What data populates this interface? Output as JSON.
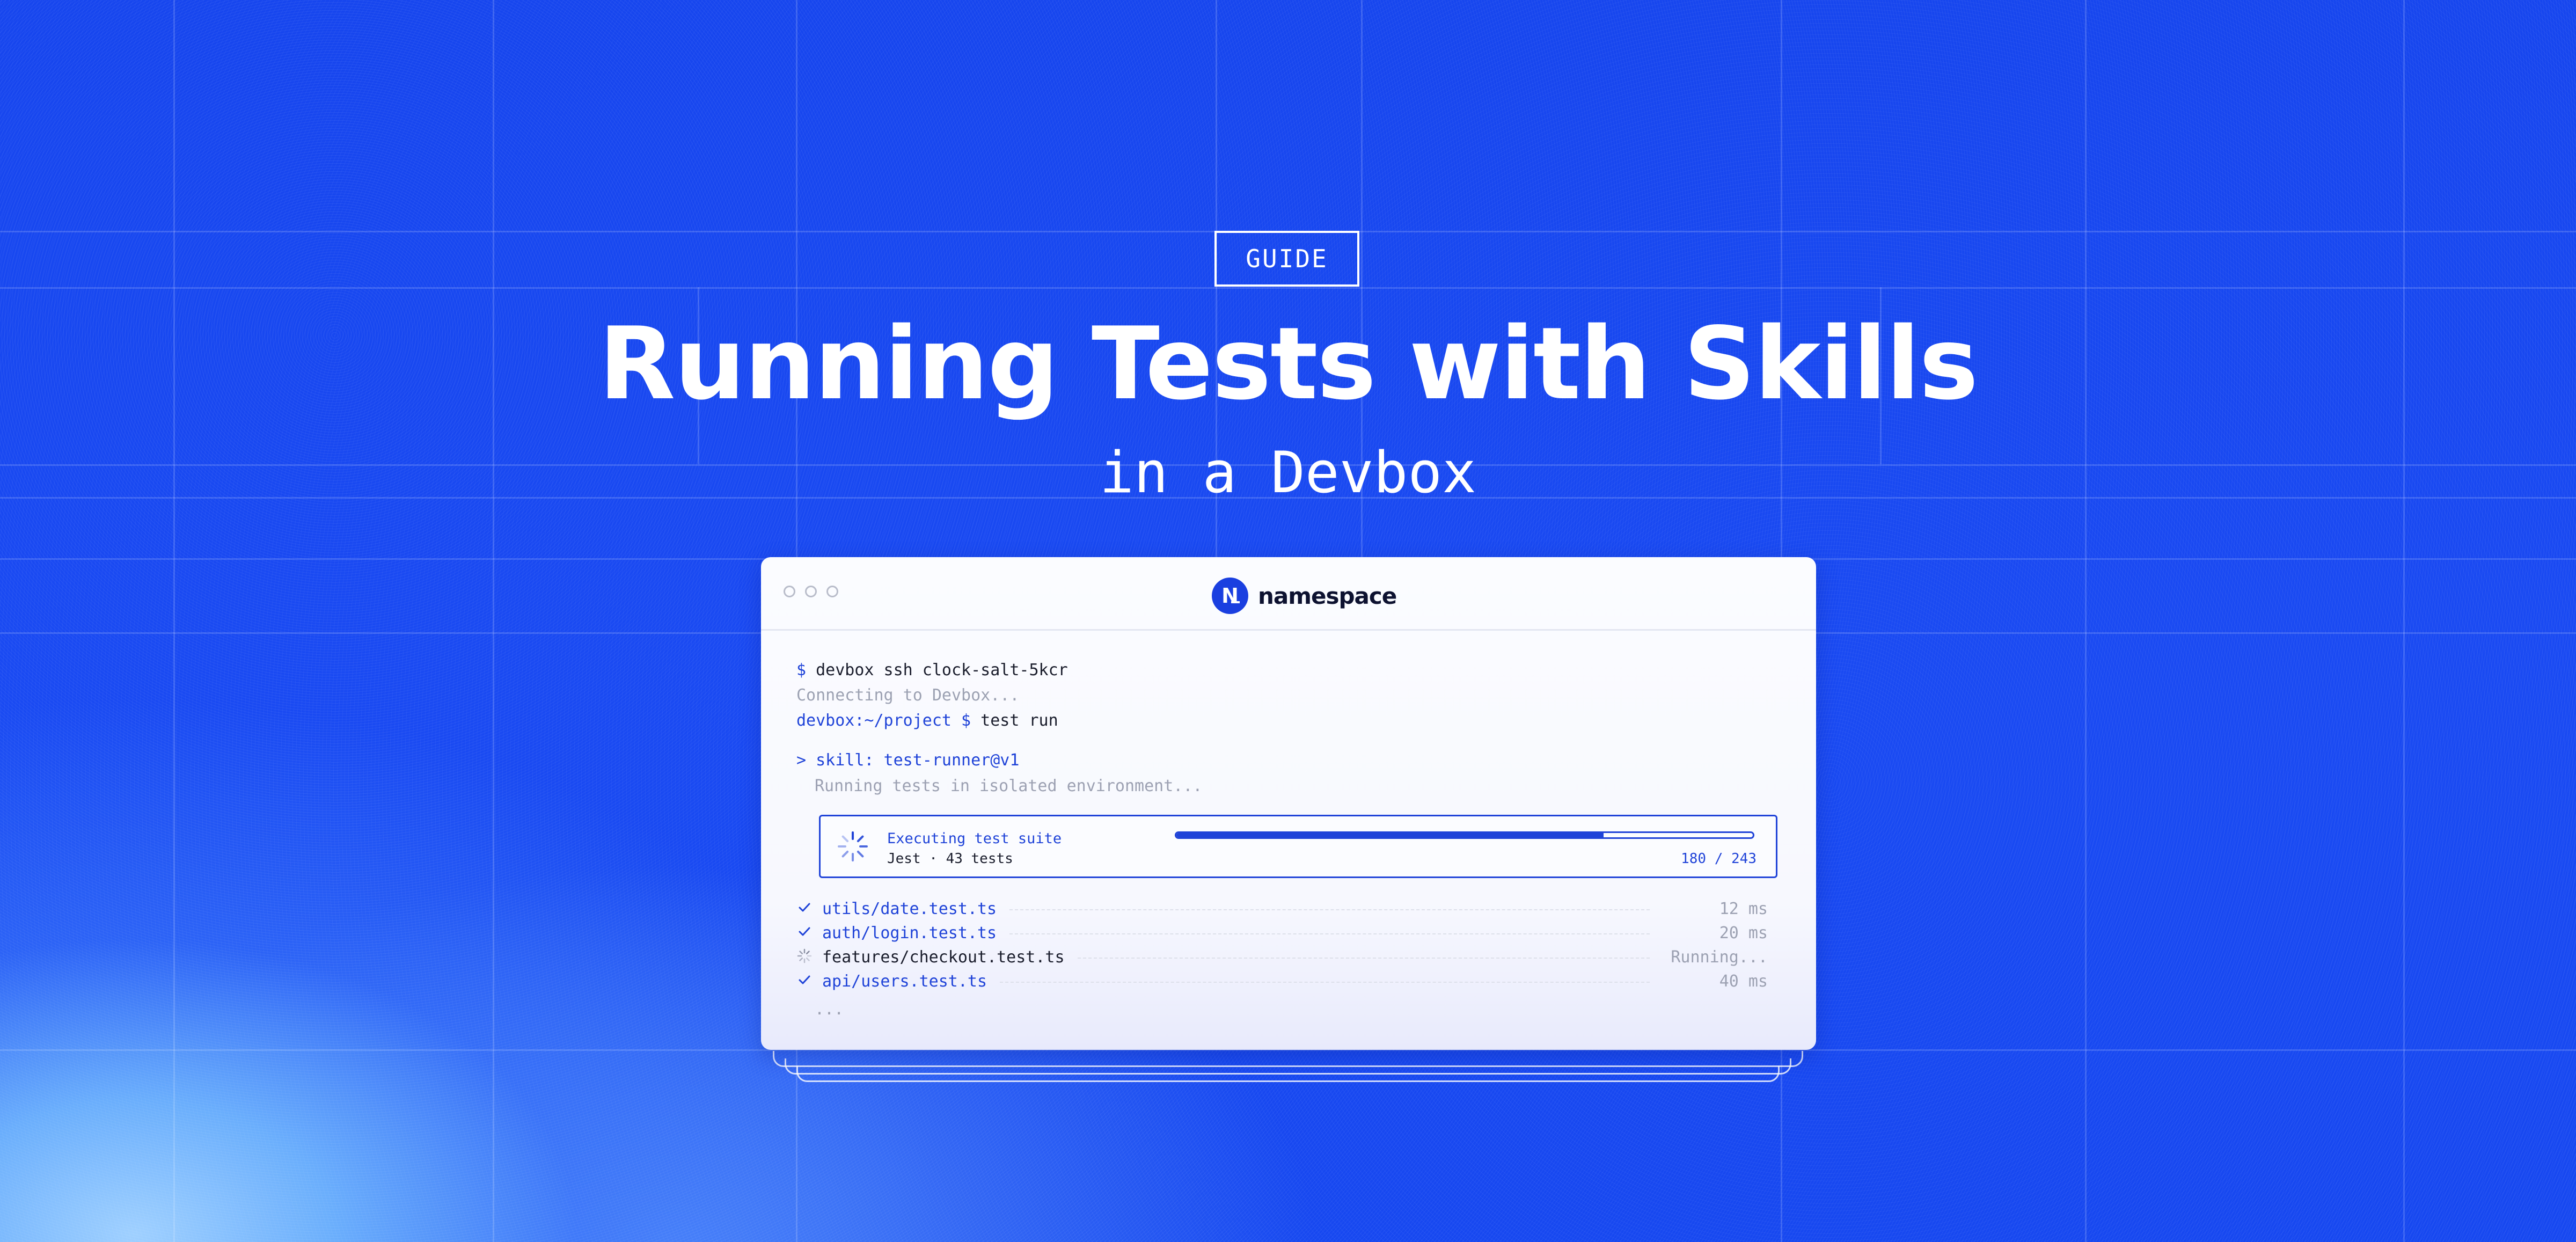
{
  "hero": {
    "badge": "GUIDE",
    "title": "Running Tests with Skills",
    "subtitle": "in a Devbox"
  },
  "window": {
    "brand": "namespace",
    "brand_logo_letter": "N",
    "terminal": {
      "line1_prompt": "$",
      "line1_cmd": "devbox ssh clock-salt-5kcr",
      "line2": "Connecting to Devbox...",
      "line3_prompt": "devbox:~/project $",
      "line3_cmd": "test run",
      "skill_line": "> skill: test-runner@v1",
      "skill_status": "Running tests in isolated environment..."
    },
    "progress": {
      "title": "Executing test suite",
      "subtitle": "Jest · 43 tests",
      "done": 180,
      "total": 243,
      "count_label": "180 / 243"
    },
    "tests": [
      {
        "status": "pass",
        "name": "utils/date.test.ts",
        "time": "12 ms"
      },
      {
        "status": "pass",
        "name": "auth/login.test.ts",
        "time": "20 ms"
      },
      {
        "status": "running",
        "name": "features/checkout.test.ts",
        "time": "Running..."
      },
      {
        "status": "pass",
        "name": "api/users.test.ts",
        "time": "40 ms"
      }
    ],
    "ellipsis": "..."
  },
  "colors": {
    "background": "#1a4af2",
    "accent": "#1f43d8",
    "muted": "#9ca1b2",
    "text": "#1a1d2c"
  }
}
